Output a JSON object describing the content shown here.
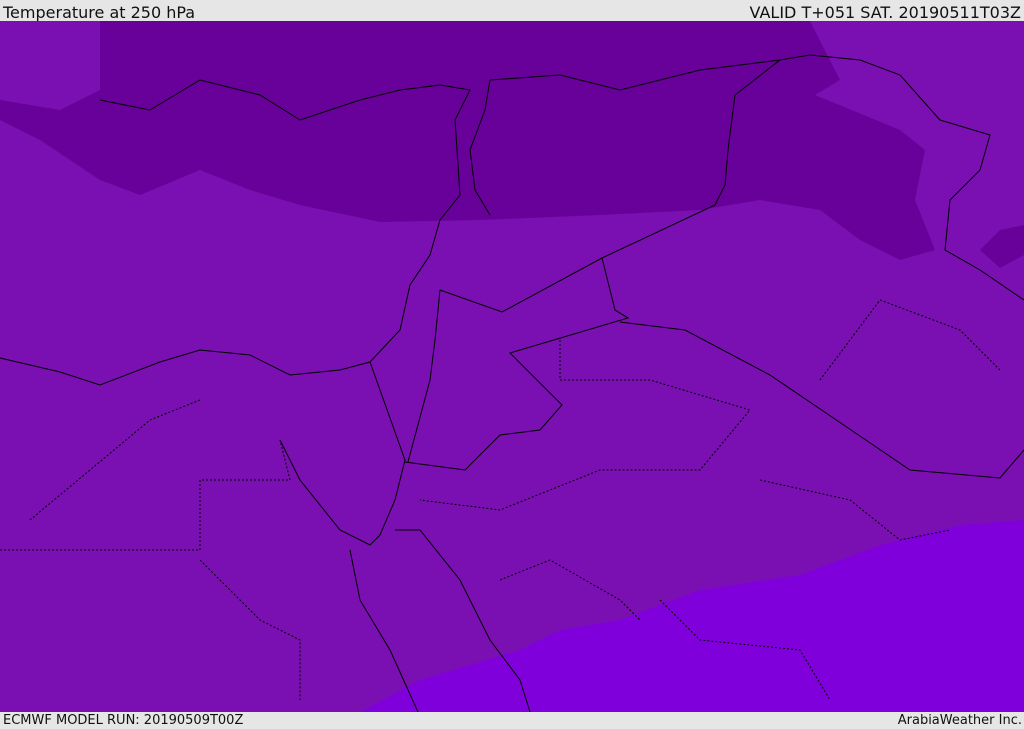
{
  "header": {
    "title": "Temperature at 250 hPa",
    "valid": "VALID T+051 SAT. 20190511T03Z"
  },
  "footer": {
    "model_run": "ECMWF MODEL RUN: 20190509T00Z",
    "credit": "ArabiaWeather Inc."
  },
  "colors": {
    "cold_band": "#680199",
    "mid_band": "#7a10b1",
    "warm_band": "#8000dc",
    "border": "#000000"
  }
}
